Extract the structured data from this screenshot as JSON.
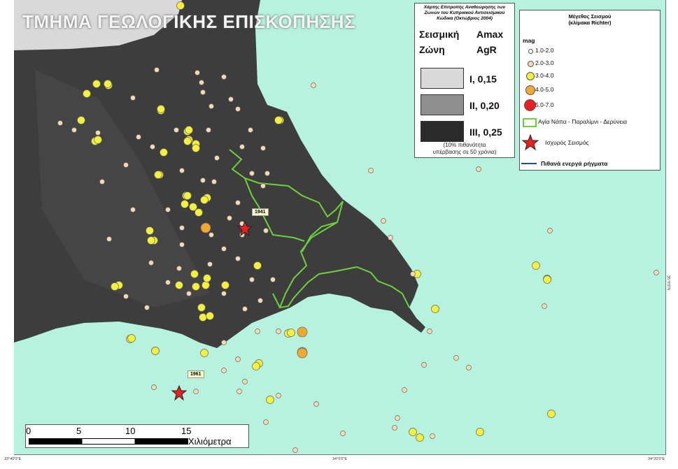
{
  "title": "ΤΜΗΜΑ ΓΕΩΛΟΓΙΚΗΣ ΕΠΙΣΚΟΠΗΣΗΣ",
  "zone_panel": {
    "heading": "Χάρτης Επιτροπής Αναθεώρησης των Ζωνών του Κυπριακού Αντισεισμικού Κώδικα (Οκτώβριος 2004)",
    "col1": [
      "Σεισμική",
      "Ζώνη"
    ],
    "col2": [
      "Amax",
      "AgR"
    ],
    "zones": [
      {
        "label": "I, 0,15",
        "color": "#d9d9d9"
      },
      {
        "label": "II, 0,20",
        "color": "#8f8f8f"
      },
      {
        "label": "III, 0,25",
        "color": "#2a2a2a"
      }
    ],
    "note": [
      "(10% πιθανότητα",
      "υπέρβασης σε 50 χρόνια)"
    ]
  },
  "legend": {
    "title": [
      "Μέγεθος Σεισμού",
      "(κλίμακα Richter)"
    ],
    "mag_label": "mag",
    "magnitudes": [
      {
        "label": "1.0-2.0",
        "color": "#ffffff"
      },
      {
        "label": "2.0-3.0",
        "color": "#f7d9b0"
      },
      {
        "label": "3.0-4.0",
        "color": "#f5f03a"
      },
      {
        "label": "4.0-5.0",
        "color": "#f0a830"
      },
      {
        "label": "5.0-7.0",
        "color": "#e82020"
      }
    ],
    "boundary_label": "Αγία Νάπα - Παραλίμνι - Δερύνεια",
    "boundary_color": "#6ad23c",
    "strong_quake_label": "Ισχυρός Σεισμός",
    "fault_label": "Πιθανά ενεργά ρήγματα",
    "fault_color": "#1f4e9c"
  },
  "events": [
    {
      "year": "1941"
    },
    {
      "year": "1961"
    }
  ],
  "scale": {
    "ticks": [
      "0",
      "5",
      "10",
      "15"
    ],
    "unit": "Χιλιόμετρα"
  },
  "coords": {
    "bottom": [
      "33°40'0\"E",
      "34°0'0\"E",
      "34°20'0\"E"
    ],
    "right": "35°0'0\"N"
  }
}
